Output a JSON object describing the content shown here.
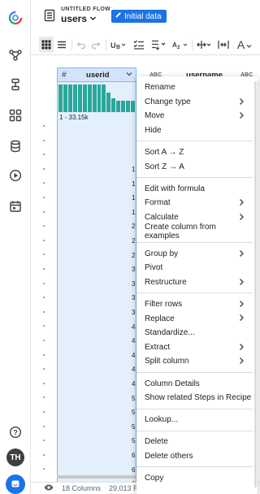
{
  "header": {
    "flow_subtitle": "UNTITLED FLOW",
    "flow_name": "users",
    "initial_data_label": "Initial data"
  },
  "toolbar": {
    "items": [
      "grid-view-icon",
      "list-view-icon",
      "undo-icon",
      "redo-icon",
      "column-type-icon",
      "column-validate-icon",
      "column-add-icon",
      "replace-icon",
      "split-icon",
      "columns-icon",
      "font-icon"
    ],
    "font_label": "A"
  },
  "columns": {
    "row_header_symbol": "#",
    "userid": {
      "type_label": "#",
      "name": "userid"
    },
    "username": {
      "type_label": "ABC",
      "name": "username"
    },
    "third": {
      "type_label": "ABC"
    }
  },
  "histogram": {
    "bars": [
      1,
      1,
      1,
      1,
      1,
      1,
      1,
      1,
      1,
      1,
      0.72,
      0.5,
      0.42,
      0.42,
      0.42,
      0.42
    ],
    "range_label": "1 - 33.15k"
  },
  "cell_values": [
    "1",
    "1",
    "1",
    "1",
    "2",
    "2",
    "2",
    "3",
    "3",
    "3",
    "3",
    "4",
    "4",
    "4",
    "4",
    "4",
    "5",
    "5",
    "5",
    "5",
    "6",
    "6",
    "6",
    "7",
    "7"
  ],
  "context_menu": {
    "groups": [
      [
        {
          "label": "Rename",
          "submenu": false
        },
        {
          "label": "Change type",
          "submenu": true
        },
        {
          "label": "Move",
          "submenu": true
        },
        {
          "label": "Hide",
          "submenu": false
        }
      ],
      [
        {
          "label": "Sort A → Z",
          "submenu": false
        },
        {
          "label": "Sort Z → A",
          "submenu": false
        }
      ],
      [
        {
          "label": "Edit with formula",
          "submenu": false
        },
        {
          "label": "Format",
          "submenu": true
        },
        {
          "label": "Calculate",
          "submenu": true
        },
        {
          "label": "Create column from examples",
          "submenu": false
        }
      ],
      [
        {
          "label": "Group by",
          "submenu": true
        },
        {
          "label": "Pivot",
          "submenu": false
        },
        {
          "label": "Restructure",
          "submenu": true
        }
      ],
      [
        {
          "label": "Filter rows",
          "submenu": true
        },
        {
          "label": "Replace",
          "submenu": true
        },
        {
          "label": "Standardize...",
          "submenu": false
        },
        {
          "label": "Extract",
          "submenu": true
        },
        {
          "label": "Split column",
          "submenu": true
        }
      ],
      [
        {
          "label": "Column Details",
          "submenu": false
        },
        {
          "label": "Show related Steps in Recipe",
          "submenu": false
        }
      ],
      [
        {
          "label": "Lookup...",
          "submenu": false
        }
      ],
      [
        {
          "label": "Delete",
          "submenu": false
        },
        {
          "label": "Delete others",
          "submenu": false
        }
      ],
      [
        {
          "label": "Copy",
          "submenu": false
        }
      ]
    ]
  },
  "status_bar": {
    "columns": "18 Columns",
    "rows": "29,013 R"
  },
  "user": {
    "initials": "TH"
  },
  "colors": {
    "accent": "#1a73e8",
    "histogram": "#2aa79b",
    "selected_column": "#e3f0fb"
  }
}
